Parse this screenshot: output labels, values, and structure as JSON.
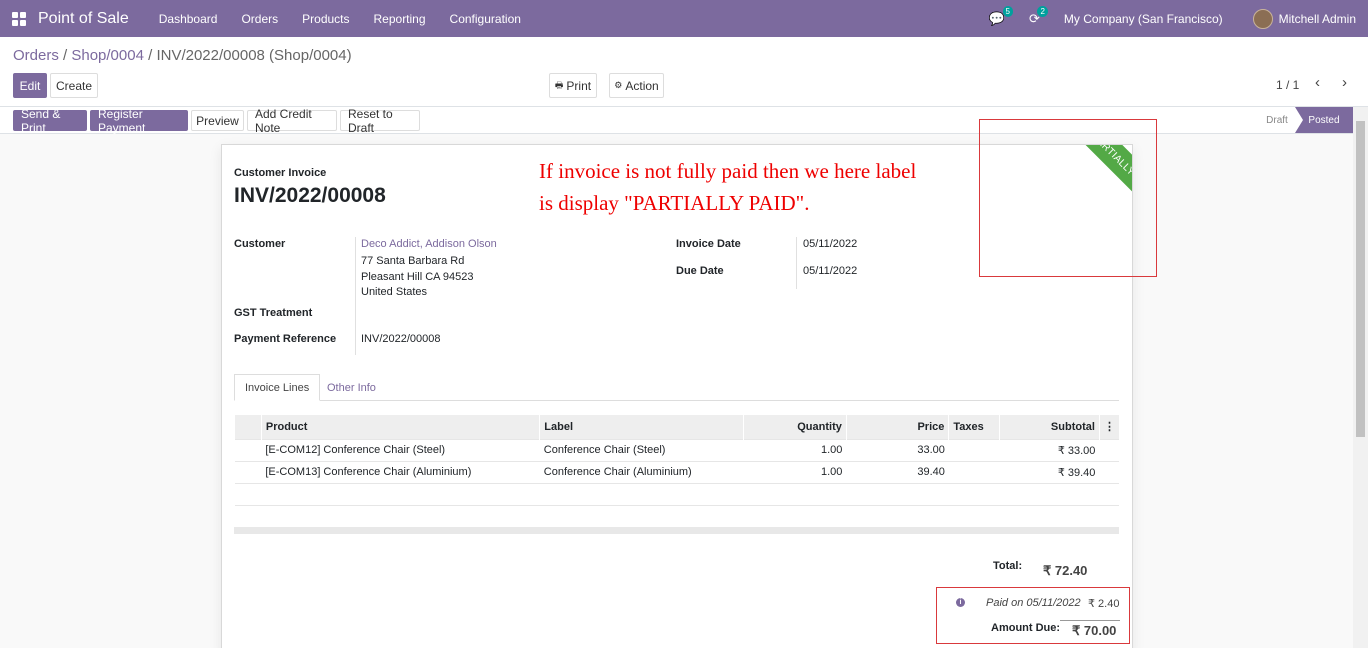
{
  "navbar": {
    "app": "Point of Sale",
    "menu": [
      "Dashboard",
      "Orders",
      "Products",
      "Reporting",
      "Configuration"
    ],
    "chat_count": "5",
    "activity_count": "2",
    "company": "My Company (San Francisco)",
    "user": "Mitchell Admin"
  },
  "breadcrumb": {
    "part1": "Orders",
    "part2": "Shop/0004",
    "current": "INV/2022/00008 (Shop/0004)"
  },
  "buttons": {
    "edit": "Edit",
    "create": "Create",
    "print": "Print",
    "action": "Action",
    "send_print": "Send & Print",
    "register_payment": "Register Payment",
    "preview": "Preview",
    "credit_note": "Add Credit Note",
    "reset": "Reset to Draft"
  },
  "pager": {
    "value": "1 / 1"
  },
  "status": {
    "draft": "Draft",
    "posted": "Posted"
  },
  "invoice": {
    "type": "Customer Invoice",
    "number": "INV/2022/00008",
    "customer_label": "Customer",
    "customer_name": "Deco Addict, Addison Olson",
    "addr1": "77 Santa Barbara Rd",
    "addr2": "Pleasant Hill CA 94523",
    "addr3": "United States",
    "gst_label": "GST Treatment",
    "payref_label": "Payment Reference",
    "payref": "INV/2022/00008",
    "invoice_date_label": "Invoice Date",
    "invoice_date": "05/11/2022",
    "due_date_label": "Due Date",
    "due_date": "05/11/2022",
    "ribbon": "PARTIALLY PAID"
  },
  "annotation": {
    "line1": "If invoice is not fully paid then we here label",
    "line2": "is display \"PARTIALLY PAID\"."
  },
  "tabs": {
    "lines": "Invoice Lines",
    "other": "Other Info"
  },
  "table": {
    "headers": {
      "product": "Product",
      "label": "Label",
      "quantity": "Quantity",
      "price": "Price",
      "taxes": "Taxes",
      "subtotal": "Subtotal"
    },
    "rows": [
      {
        "product": "[E-COM12] Conference Chair (Steel)",
        "label": "Conference Chair (Steel)",
        "quantity": "1.00",
        "price": "33.00",
        "taxes": "",
        "subtotal": "₹ 33.00"
      },
      {
        "product": "[E-COM13] Conference Chair (Aluminium)",
        "label": "Conference Chair (Aluminium)",
        "quantity": "1.00",
        "price": "39.40",
        "taxes": "",
        "subtotal": "₹ 39.40"
      }
    ]
  },
  "totals": {
    "total_label": "Total:",
    "total": "₹ 72.40",
    "paid_on": "Paid on 05/11/2022",
    "paid_amount": "₹ 2.40",
    "due_label": "Amount Due:",
    "due": "₹ 70.00"
  }
}
